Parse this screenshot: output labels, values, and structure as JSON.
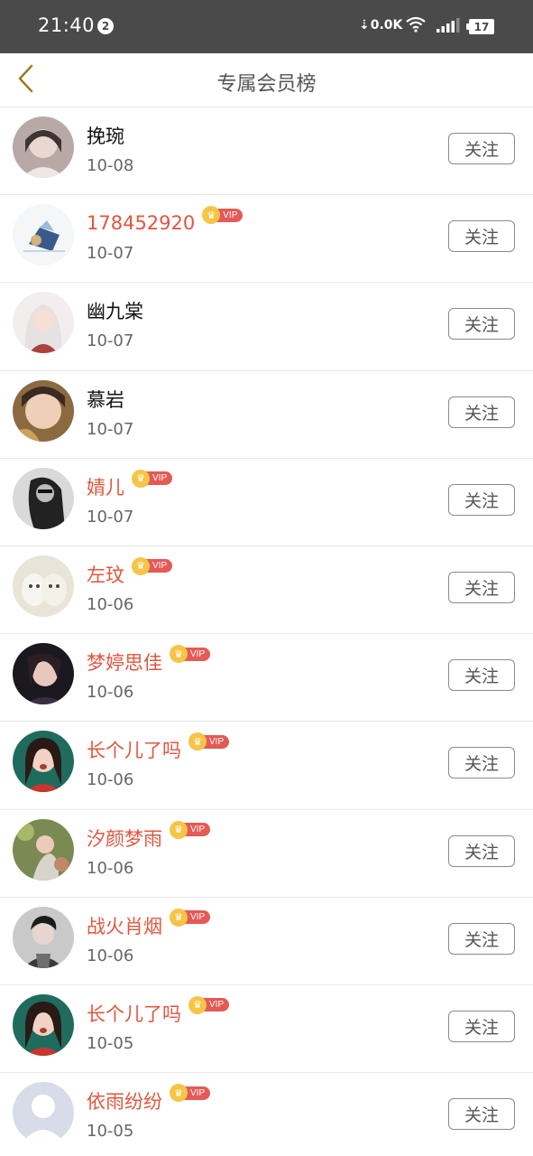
{
  "status_bar": {
    "time": "21:40",
    "notification_count": "2",
    "net_speed": "0.0K",
    "battery": "17"
  },
  "header": {
    "title": "专属会员榜",
    "back_icon": "chevron-left-icon"
  },
  "colors": {
    "status_bar_bg": "#4a4a4a",
    "vip_name": "#e0573d",
    "normal_name": "#111111",
    "vip_pill": "#e45a55",
    "vip_crown": "#f6c447",
    "back_icon": "#d9b13b"
  },
  "members": [
    {
      "name": "挽琬",
      "date": "10-08",
      "vip": false,
      "follow_label": "关注"
    },
    {
      "name": "178452920",
      "date": "10-07",
      "vip": true,
      "vip_label": "VIP",
      "follow_label": "关注"
    },
    {
      "name": "幽九棠",
      "date": "10-07",
      "vip": false,
      "follow_label": "关注"
    },
    {
      "name": "慕岩",
      "date": "10-07",
      "vip": false,
      "follow_label": "关注"
    },
    {
      "name": "婧儿",
      "date": "10-07",
      "vip": true,
      "vip_label": "VIP",
      "follow_label": "关注"
    },
    {
      "name": "左玟",
      "date": "10-06",
      "vip": true,
      "vip_label": "VIP",
      "follow_label": "关注"
    },
    {
      "name": "梦婷思佳",
      "date": "10-06",
      "vip": true,
      "vip_label": "VIP",
      "follow_label": "关注"
    },
    {
      "name": "长个儿了吗",
      "date": "10-06",
      "vip": true,
      "vip_label": "VIP",
      "follow_label": "关注"
    },
    {
      "name": "汐颜梦雨",
      "date": "10-06",
      "vip": true,
      "vip_label": "VIP",
      "follow_label": "关注"
    },
    {
      "name": "战火肖烟",
      "date": "10-06",
      "vip": true,
      "vip_label": "VIP",
      "follow_label": "关注"
    },
    {
      "name": "长个儿了吗",
      "date": "10-05",
      "vip": true,
      "vip_label": "VIP",
      "follow_label": "关注"
    },
    {
      "name": "依雨纷纷",
      "date": "10-05",
      "vip": true,
      "vip_label": "VIP",
      "follow_label": "关注"
    }
  ]
}
